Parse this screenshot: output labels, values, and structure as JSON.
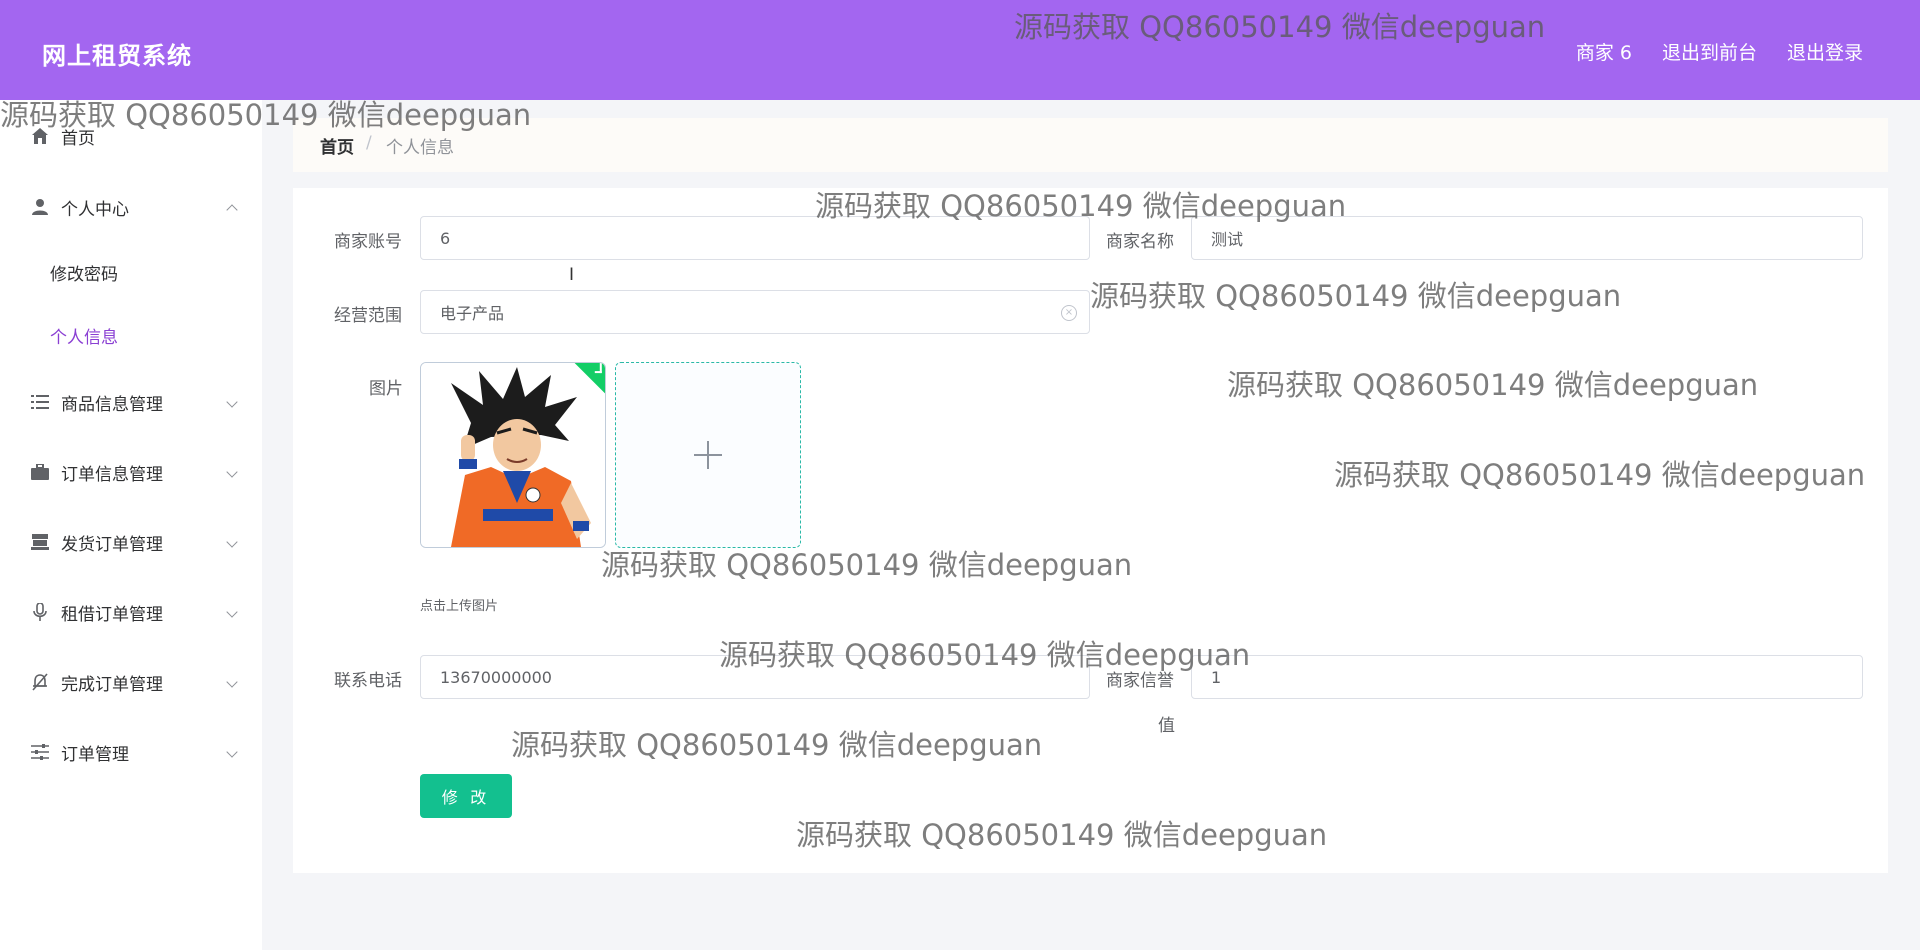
{
  "header": {
    "brand": "网上租贸系统",
    "nav": [
      "商家 6",
      "退出到前台",
      "退出登录"
    ]
  },
  "sidebar": {
    "items": [
      {
        "label": "首页",
        "icon": "home-icon"
      },
      {
        "label": "个人中心",
        "icon": "user-icon",
        "expanded": true,
        "children": [
          {
            "label": "修改密码"
          },
          {
            "label": "个人信息",
            "active": true
          }
        ]
      },
      {
        "label": "商品信息管理",
        "icon": "list-icon"
      },
      {
        "label": "订单信息管理",
        "icon": "briefcase-icon"
      },
      {
        "label": "发货订单管理",
        "icon": "shop-icon"
      },
      {
        "label": "租借订单管理",
        "icon": "microphone-icon"
      },
      {
        "label": "完成订单管理",
        "icon": "bell-off-icon"
      },
      {
        "label": "订单管理",
        "icon": "sliders-icon"
      }
    ]
  },
  "breadcrumb": {
    "home": "首页",
    "separator": "/",
    "current": "个人信息"
  },
  "form": {
    "merchant_account": {
      "label": "商家账号",
      "value": "6"
    },
    "merchant_name": {
      "label": "商家名称",
      "value": "测试"
    },
    "business_scope": {
      "label": "经营范围",
      "value": "电子产品"
    },
    "image": {
      "label": "图片",
      "hint": "点击上传图片"
    },
    "phone": {
      "label": "联系电话",
      "value": "13670000000"
    },
    "credit": {
      "label_line1": "商家信誉",
      "label_line2": "值",
      "value": "1"
    },
    "submit_label": "修 改"
  },
  "watermark": "源码获取 QQ86050149 微信deepguan",
  "colors": {
    "header": "#a366f0",
    "active_menu": "#8a3fd3",
    "submit": "#13c08f",
    "success_badge": "#13ce66"
  }
}
